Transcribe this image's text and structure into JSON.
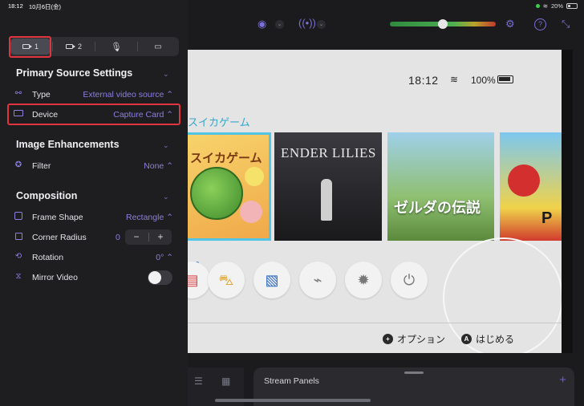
{
  "status_bar": {
    "time": "18:12",
    "date": "10月6日(金)",
    "battery": "20%"
  },
  "source_tabs": [
    {
      "label": "1",
      "icon": "camera-icon",
      "active": true
    },
    {
      "label": "2",
      "icon": "camera-icon",
      "active": false
    },
    {
      "label": "",
      "icon": "microphone-icon",
      "active": false
    },
    {
      "label": "",
      "icon": "screen-share-icon",
      "active": false
    }
  ],
  "primary_source": {
    "title": "Primary Source Settings",
    "type": {
      "label": "Type",
      "value": "External video source ⌃"
    },
    "device": {
      "label": "Device",
      "value": "Capture Card ⌃"
    }
  },
  "image_enhancements": {
    "title": "Image Enhancements",
    "filter": {
      "label": "Filter",
      "value": "None ⌃"
    }
  },
  "composition": {
    "title": "Composition",
    "frame_shape": {
      "label": "Frame Shape",
      "value": "Rectangle ⌃"
    },
    "corner_radius": {
      "label": "Corner Radius",
      "value": "0",
      "minus": "−",
      "plus": "+"
    },
    "rotation": {
      "label": "Rotation",
      "value": "0° ⌃"
    },
    "mirror_video": {
      "label": "Mirror Video",
      "enabled": false
    }
  },
  "preview": {
    "time": "18:12",
    "battery": "100%",
    "game_title": "スイカゲーム",
    "tiles": [
      {
        "name": "suika",
        "text": "スイカゲーム"
      },
      {
        "name": "ender-lilies",
        "text": "ENDER LILIES"
      },
      {
        "name": "zelda",
        "text": "ゼルダの伝説"
      },
      {
        "name": "mario",
        "text": "P"
      }
    ],
    "hints": [
      {
        "button": "+",
        "label": "オプション"
      },
      {
        "button": "A",
        "label": "はじめる"
      }
    ]
  },
  "audio_meter": {
    "level": 0.5
  },
  "bottom_panel": {
    "title": "Stream Panels",
    "add": "+"
  },
  "colors": {
    "accent": "#7a6fd6",
    "highlight_box": "#e0343e",
    "sidebar_bg": "#1e1e21",
    "preview_bg": "#e4e4e4"
  }
}
